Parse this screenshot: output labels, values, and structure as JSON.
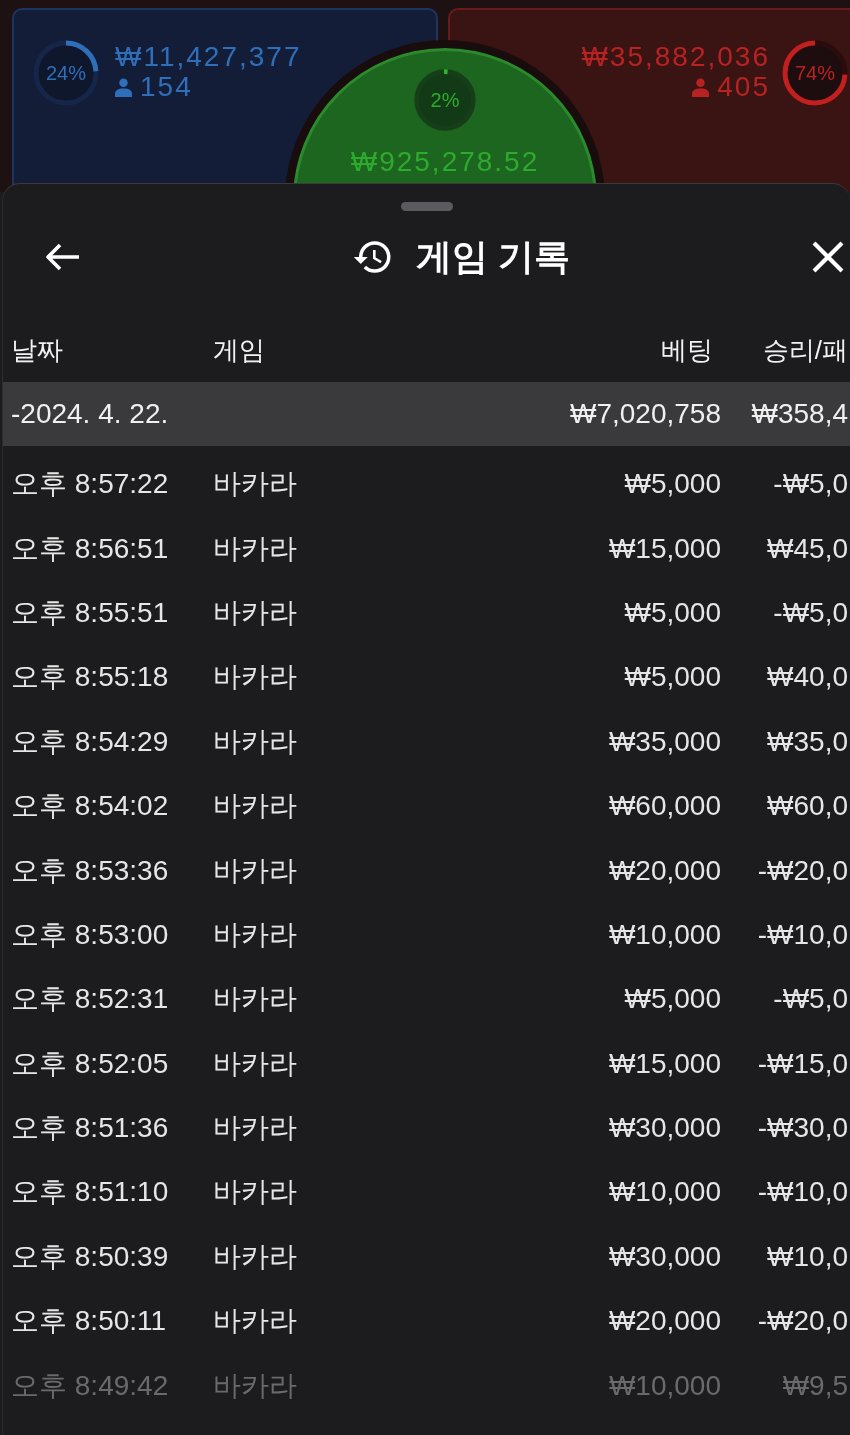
{
  "game_table": {
    "player": {
      "percent": "24%",
      "level": 0.24,
      "amount": "₩11,427,377",
      "count": "154"
    },
    "tie": {
      "percent": "2%",
      "level": 0.02,
      "amount": "₩925,278.52"
    },
    "banker": {
      "amount": "₩35,882,036",
      "count": "405",
      "percent": "74%",
      "level": 0.74
    }
  },
  "sheet": {
    "title": "게임 기록"
  },
  "table": {
    "columns": [
      "날짜",
      "게임",
      "베팅",
      "승리/패"
    ],
    "summary": {
      "date": "-2024. 4. 22.",
      "bet": "₩7,020,758",
      "result": "₩358,4"
    },
    "rows": [
      {
        "time": "오후 8:57:22",
        "game": "바카라",
        "bet": "₩5,000",
        "result": "-₩5,0"
      },
      {
        "time": "오후 8:56:51",
        "game": "바카라",
        "bet": "₩15,000",
        "result": "₩45,0"
      },
      {
        "time": "오후 8:55:51",
        "game": "바카라",
        "bet": "₩5,000",
        "result": "-₩5,0"
      },
      {
        "time": "오후 8:55:18",
        "game": "바카라",
        "bet": "₩5,000",
        "result": "₩40,0"
      },
      {
        "time": "오후 8:54:29",
        "game": "바카라",
        "bet": "₩35,000",
        "result": "₩35,0"
      },
      {
        "time": "오후 8:54:02",
        "game": "바카라",
        "bet": "₩60,000",
        "result": "₩60,0"
      },
      {
        "time": "오후 8:53:36",
        "game": "바카라",
        "bet": "₩20,000",
        "result": "-₩20,0"
      },
      {
        "time": "오후 8:53:00",
        "game": "바카라",
        "bet": "₩10,000",
        "result": "-₩10,0"
      },
      {
        "time": "오후 8:52:31",
        "game": "바카라",
        "bet": "₩5,000",
        "result": "-₩5,0"
      },
      {
        "time": "오후 8:52:05",
        "game": "바카라",
        "bet": "₩15,000",
        "result": "-₩15,0"
      },
      {
        "time": "오후 8:51:36",
        "game": "바카라",
        "bet": "₩30,000",
        "result": "-₩30,0"
      },
      {
        "time": "오후 8:51:10",
        "game": "바카라",
        "bet": "₩10,000",
        "result": "-₩10,0"
      },
      {
        "time": "오후 8:50:39",
        "game": "바카라",
        "bet": "₩30,000",
        "result": "₩10,0"
      },
      {
        "time": "오후 8:50:11",
        "game": "바카라",
        "bet": "₩20,000",
        "result": "-₩20,0"
      },
      {
        "time": "오후 8:49:42",
        "game": "바카라",
        "bet": "₩10,000",
        "result": "₩9,5"
      }
    ]
  }
}
